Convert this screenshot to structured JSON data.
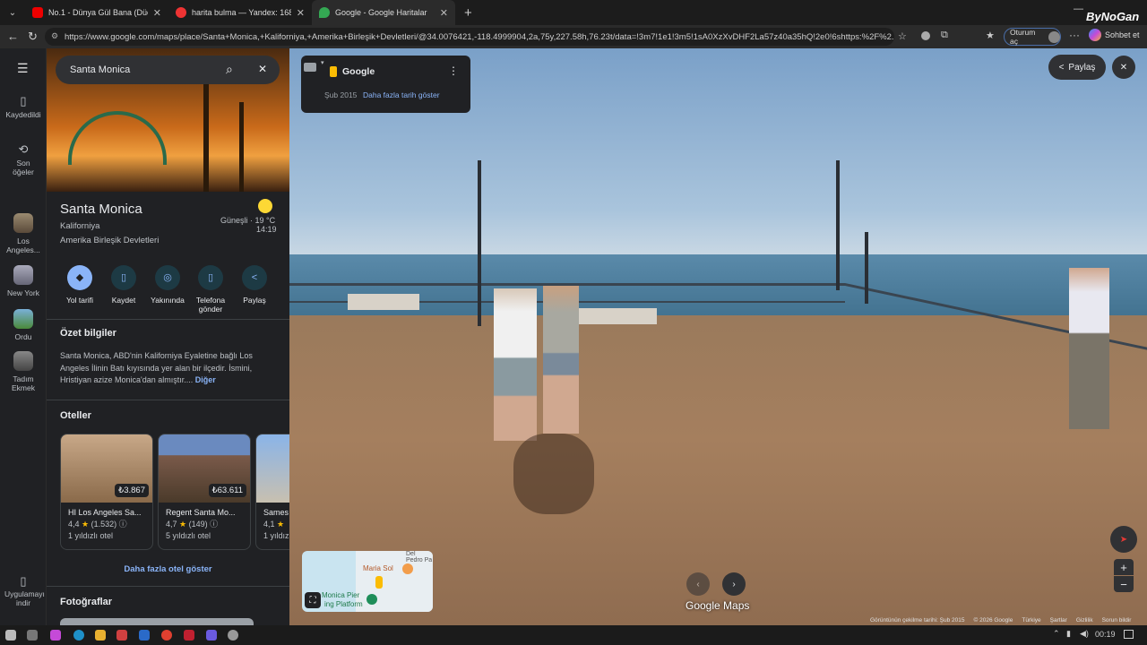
{
  "browser": {
    "tabs": [
      {
        "title": "No.1 - Dünya Gül Bana (Düet",
        "icon": "youtube-icon",
        "active": false
      },
      {
        "title": "harita bulma — Yandex: 168 bin s",
        "icon": "yandex-icon",
        "active": false
      },
      {
        "title": "Google - Google Haritalar",
        "icon": "maps-icon",
        "active": true
      }
    ],
    "url": "https://www.google.com/maps/place/Santa+Monica,+Kaliforniya,+Amerika+Birleşik+Devletleri/@34.0076421,-118.4999904,2a,75y,227.58h,76.23t/data=!3m7!1e1!3m5!1sA0XzXvDHF2La57z40a35hQ!2e0!6shttps:%2F%2...",
    "signin_label": "Oturum aç",
    "chat_label": "Sohbet et",
    "watermark": "ByNoGan"
  },
  "rail": {
    "saved": "Kaydedildi",
    "recent": "Son öğeler",
    "recent_items": [
      "Los Angeles...",
      "New York",
      "Ordu",
      "Tadım Ekmek"
    ],
    "download": "Uygulamayı indir"
  },
  "panel": {
    "search_value": "Santa Monica",
    "place_name": "Santa Monica",
    "region": "Kaliforniya",
    "country": "Amerika Birleşik Devletleri",
    "weather": "Güneşli · 19 °C",
    "time": "14:19",
    "actions": [
      "Yol tarifi",
      "Kaydet",
      "Yakınında",
      "Telefona gönder",
      "Paylaş"
    ],
    "summary_title": "Özet bilgiler",
    "summary_text": "Santa Monica, ABD'nin Kaliforniya Eyaletine bağlı Los Angeles İlinin Batı kıyısında yer alan bir ilçedir. İsmini, Hristiyan azize Monica'dan almıştır....",
    "more_link": "Diğer",
    "hotels_title": "Oteller",
    "hotels": [
      {
        "name": "HI Los Angeles Sa...",
        "rating": "4,4",
        "reviews": "(1.532)",
        "class": "1 yıldızlı otel",
        "price": "₺3.867"
      },
      {
        "name": "Regent Santa Mo...",
        "rating": "4,7",
        "reviews": "(149)",
        "class": "5 yıldızlı otel",
        "price": "₺63.611"
      },
      {
        "name": "Sames",
        "rating": "4,1",
        "reviews": "",
        "class": "1 yıldız",
        "price": ""
      }
    ],
    "more_hotels": "Daha fazla otel göster",
    "photos_title": "Fotoğraflar"
  },
  "streetview": {
    "provider": "Google",
    "date": "Şub 2015",
    "more_dates": "Daha fazla tarih göster",
    "share": "Paylaş",
    "brand": "Google Maps",
    "minimap_labels": [
      "Del Pedro Pa",
      "Maria Sol",
      "Monica Pier",
      "ing Platform"
    ],
    "footer": [
      "Görüntünün çekilme tarihi: Şub 2015",
      "© 2026 Google",
      "Türkiye",
      "Şartlar",
      "Gizlilik",
      "Sorun bildir"
    ]
  },
  "taskbar": {
    "time": "00:19"
  }
}
